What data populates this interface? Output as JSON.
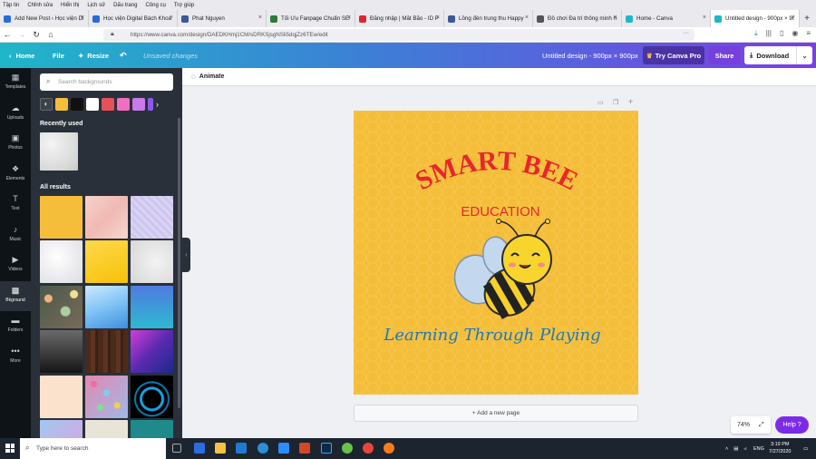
{
  "browser": {
    "menu": [
      "Tập tin",
      "Chỉnh sửa",
      "Hiển thị",
      "Lịch sử",
      "Dấu trang",
      "Công cụ",
      "Trợ giúp"
    ],
    "tabs": [
      {
        "title": "Add New Post ‹ Học viện Di",
        "color": "#2a6bd9"
      },
      {
        "title": "Học viện Digital Bách Khoa",
        "color": "#2a6bd9"
      },
      {
        "title": "Phat Nguyen",
        "color": "#3b5998"
      },
      {
        "title": "Tối Ưu Fanpage Chuẩn SEO",
        "color": "#2d7a3a"
      },
      {
        "title": "Đăng nhập | Mắt Bão - ID P",
        "color": "#e0242c"
      },
      {
        "title": "Lồng đèn trung thu Happy",
        "color": "#3b5998"
      },
      {
        "title": "Đồ chơi Đa trí thông minh h",
        "color": "#555555"
      },
      {
        "title": "Home - Canva",
        "color": "#1fb6c9"
      },
      {
        "title": "Untitled design - 900px × 90",
        "color": "#1fb6c9"
      }
    ],
    "url": "https://www.canva.com/design/DAEDKHmj1CM/sDRKSjsgNSli5dqjZz6TEw/edit",
    "url_more": "···"
  },
  "canva": {
    "home": "Home",
    "file": "File",
    "resize": "Resize",
    "unsaved": "Unsaved changes",
    "design_title": "Untitled design - 900px × 900px",
    "try_pro": "Try Canva Pro",
    "share": "Share",
    "download": "Download",
    "animate": "Animate",
    "nav": [
      "Templates",
      "Uploads",
      "Photos",
      "Elements",
      "Text",
      "Music",
      "Videos",
      "Bkground",
      "Folders",
      "More"
    ],
    "active_nav": "Bkground",
    "search_placeholder": "Search backgrounds",
    "recently_used": "Recently used",
    "all_results": "All results",
    "swatch_colors": [
      "#f5be3a",
      "#111111",
      "#ffffff",
      "#e6505a",
      "#f06ec0",
      "#c87ae6",
      "#8a5af0"
    ],
    "design": {
      "title": "SMART BEE",
      "subtitle": "EDUCATION",
      "tagline": "Learning Through Playing",
      "title_color": "#e8262c",
      "subtitle_color": "#e8262c",
      "tagline_color": "#1d78c1"
    },
    "add_page": "+ Add a new page",
    "zoom": "74%",
    "help": "Help ?"
  },
  "taskbar": {
    "search": "Type here to search",
    "lang": "ENG",
    "time": "3:19 PM",
    "date": "7/27/2020"
  }
}
